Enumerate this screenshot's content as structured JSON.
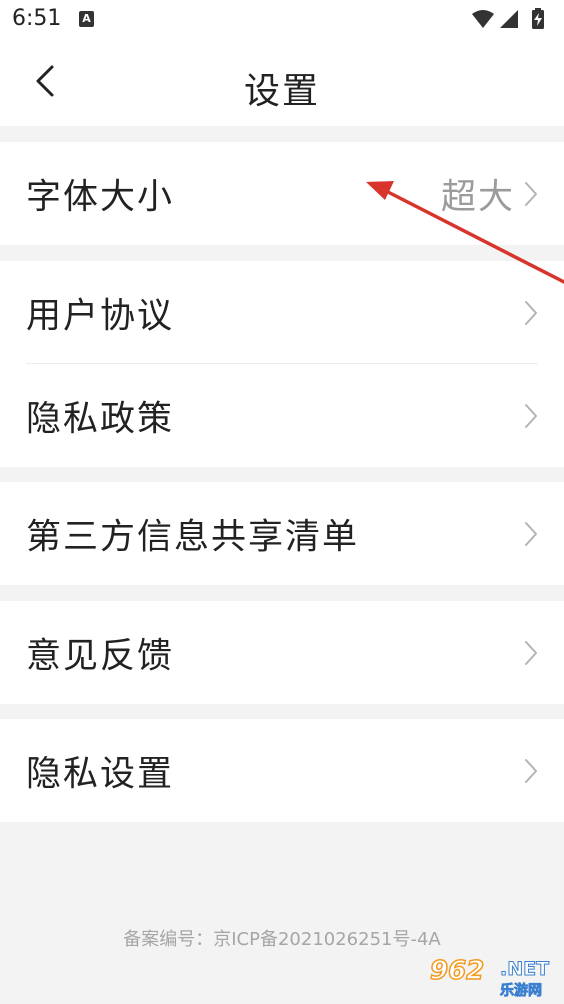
{
  "status_bar": {
    "time": "6:51",
    "notification_icon": "a-icon",
    "icons": [
      "wifi-icon",
      "cellular-signal-icon",
      "battery-charging-icon"
    ]
  },
  "header": {
    "back_icon": "chevron-left-icon",
    "title": "设置"
  },
  "groups": [
    {
      "items": [
        {
          "label": "字体大小",
          "value": "超大",
          "icon": "chevron-right-icon"
        }
      ]
    },
    {
      "items": [
        {
          "label": "用户协议",
          "icon": "chevron-right-icon"
        },
        {
          "label": "隐私政策",
          "icon": "chevron-right-icon"
        }
      ]
    },
    {
      "items": [
        {
          "label": "第三方信息共享清单",
          "icon": "chevron-right-icon"
        }
      ]
    },
    {
      "items": [
        {
          "label": "意见反馈",
          "icon": "chevron-right-icon"
        }
      ]
    },
    {
      "items": [
        {
          "label": "隐私设置",
          "icon": "chevron-right-icon"
        }
      ]
    }
  ],
  "footer": {
    "icp": "备案编号：京ICP备2021026251号-4A"
  },
  "annotation": {
    "type": "arrow",
    "color": "#d9342b"
  },
  "watermark": {
    "number": "962",
    "domain": ".NET",
    "sub": "乐游网"
  },
  "colors": {
    "background": "#f3f3f3",
    "surface": "#ffffff",
    "text_primary": "#222222",
    "text_secondary": "#9b9b9b",
    "footer_text": "#a6a6a6",
    "divider": "#ececec"
  }
}
